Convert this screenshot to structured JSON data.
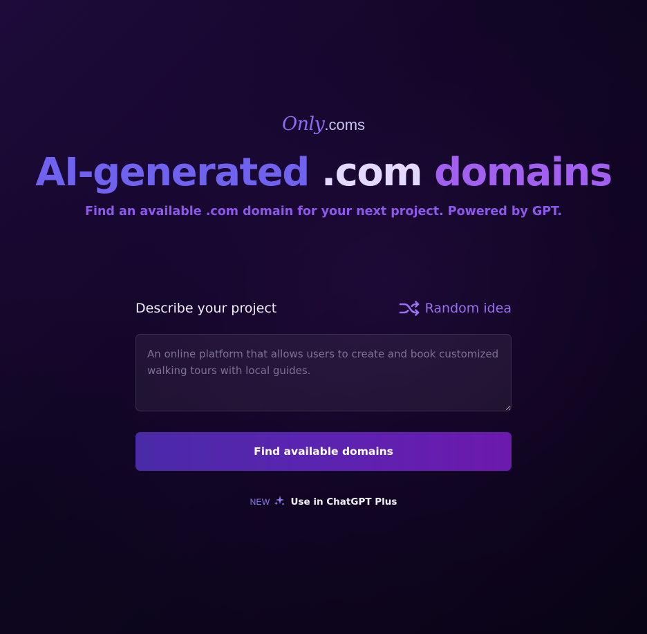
{
  "logo": {
    "script": "Only",
    "suffix": ".coms"
  },
  "hero": {
    "headline_part1": "AI-generated",
    "headline_part2": ".com",
    "headline_part3": "domains",
    "subtitle": "Find an available .com domain for your next project. Powered by GPT."
  },
  "form": {
    "label": "Describe your project",
    "random_label": "Random idea",
    "random_icon": "shuffle-icon",
    "textarea_placeholder": "An online platform that allows users to create and book customized walking tours with local guides.",
    "textarea_value": "",
    "submit_label": "Find available domains"
  },
  "promo": {
    "badge": "NEW",
    "icon": "sparkles-icon",
    "link_label": "Use in ChatGPT Plus"
  },
  "colors": {
    "background": "#140628",
    "accent_blue": "#6f62ee",
    "accent_purple": "#a35ff0",
    "button_start": "#4a2aa6",
    "button_end": "#6c1aae"
  }
}
